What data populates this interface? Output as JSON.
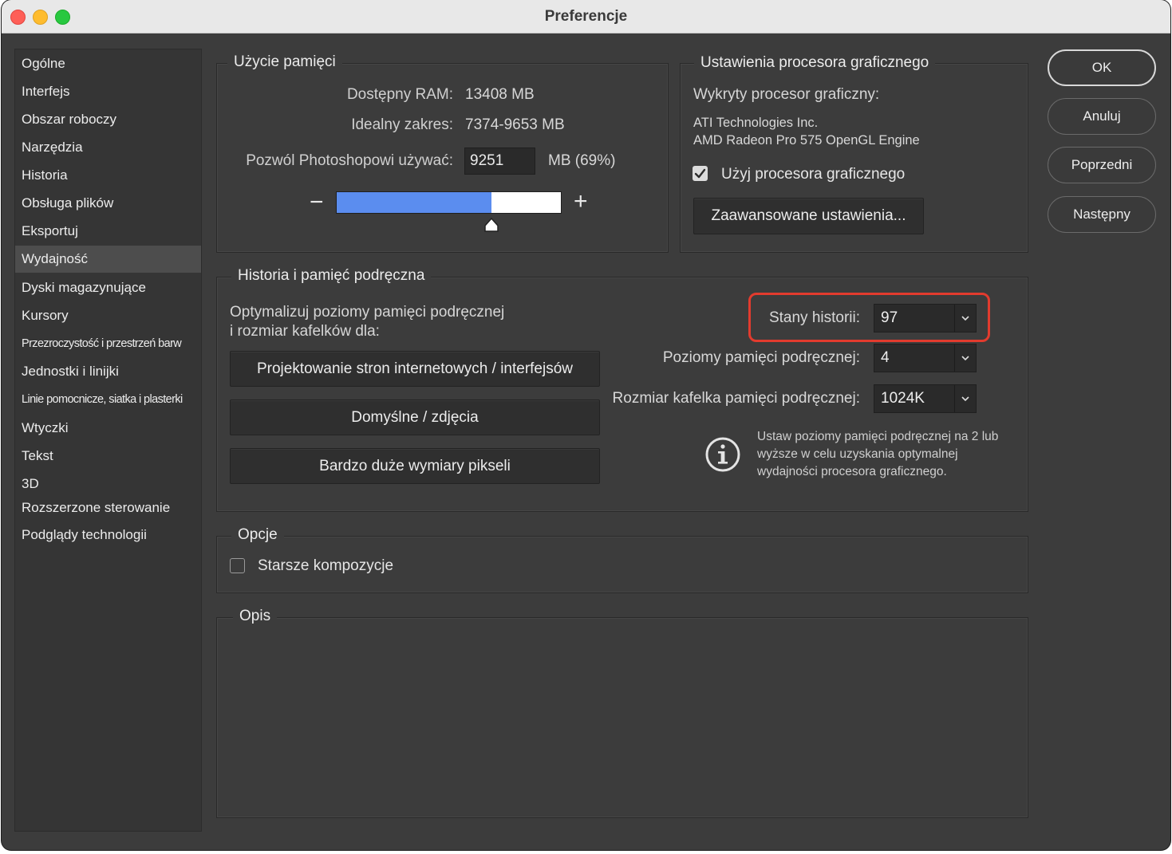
{
  "window": {
    "title": "Preferencje"
  },
  "sidebar": {
    "items": [
      {
        "label": "Ogólne"
      },
      {
        "label": "Interfejs"
      },
      {
        "label": "Obszar roboczy"
      },
      {
        "label": "Narzędzia"
      },
      {
        "label": "Historia"
      },
      {
        "label": "Obsługa plików"
      },
      {
        "label": "Eksportuj"
      },
      {
        "label": "Wydajność"
      },
      {
        "label": "Dyski magazynujące"
      },
      {
        "label": "Kursory"
      },
      {
        "label": "Przezroczystość i przestrzeń barw"
      },
      {
        "label": "Jednostki i linijki"
      },
      {
        "label": "Linie pomocnicze, siatka i plasterki"
      },
      {
        "label": "Wtyczki"
      },
      {
        "label": "Tekst"
      },
      {
        "label": "3D"
      },
      {
        "label": "Rozszerzone sterowanie"
      },
      {
        "label": "Podglądy technologii"
      }
    ],
    "active": "Wydajność"
  },
  "memory": {
    "legend": "Użycie pamięci",
    "available_label": "Dostępny RAM:",
    "available_value": "13408 MB",
    "ideal_label": "Idealny zakres:",
    "ideal_value": "7374-9653 MB",
    "allow_label": "Pozwól Photoshopowi używać:",
    "allow_value": "9251",
    "allow_unit": "MB (69%)",
    "slider_fraction": 0.69,
    "minus": "−",
    "plus": "+"
  },
  "gpu": {
    "legend": "Ustawienia procesora graficznego",
    "detected_label": "Wykryty procesor graficzny:",
    "vendor": "ATI Technologies Inc.",
    "model": "AMD Radeon Pro 575 OpenGL Engine",
    "use_gpu_label": "Użyj procesora graficznego",
    "use_gpu_checked": true,
    "advanced_button": "Zaawansowane ustawienia..."
  },
  "history_cache": {
    "legend": "Historia i pamięć podręczna",
    "optimize_line1": "Optymalizuj poziomy pamięci podręcznej",
    "optimize_line2": "i rozmiar kafelków dla:",
    "btn_web": "Projektowanie stron internetowych / interfejsów",
    "btn_default": "Domyślne / zdjęcia",
    "btn_large": "Bardzo duże wymiary pikseli",
    "history_states_label": "Stany historii:",
    "history_states_value": "97",
    "cache_levels_label": "Poziomy pamięci podręcznej:",
    "cache_levels_value": "4",
    "tile_size_label": "Rozmiar kafelka pamięci podręcznej:",
    "tile_size_value": "1024K",
    "info_text": "Ustaw poziomy pamięci podręcznej na 2 lub wyższe w celu uzyskania optymalnej wydajności procesora graficznego."
  },
  "options": {
    "legend": "Opcje",
    "legacy_label": "Starsze kompozycje",
    "legacy_checked": false
  },
  "description": {
    "legend": "Opis"
  },
  "actions": {
    "ok": "OK",
    "cancel": "Anuluj",
    "prev": "Poprzedni",
    "next": "Następny"
  },
  "colors": {
    "accent_blue": "#5b8def",
    "highlight_red": "#e23b2e"
  }
}
